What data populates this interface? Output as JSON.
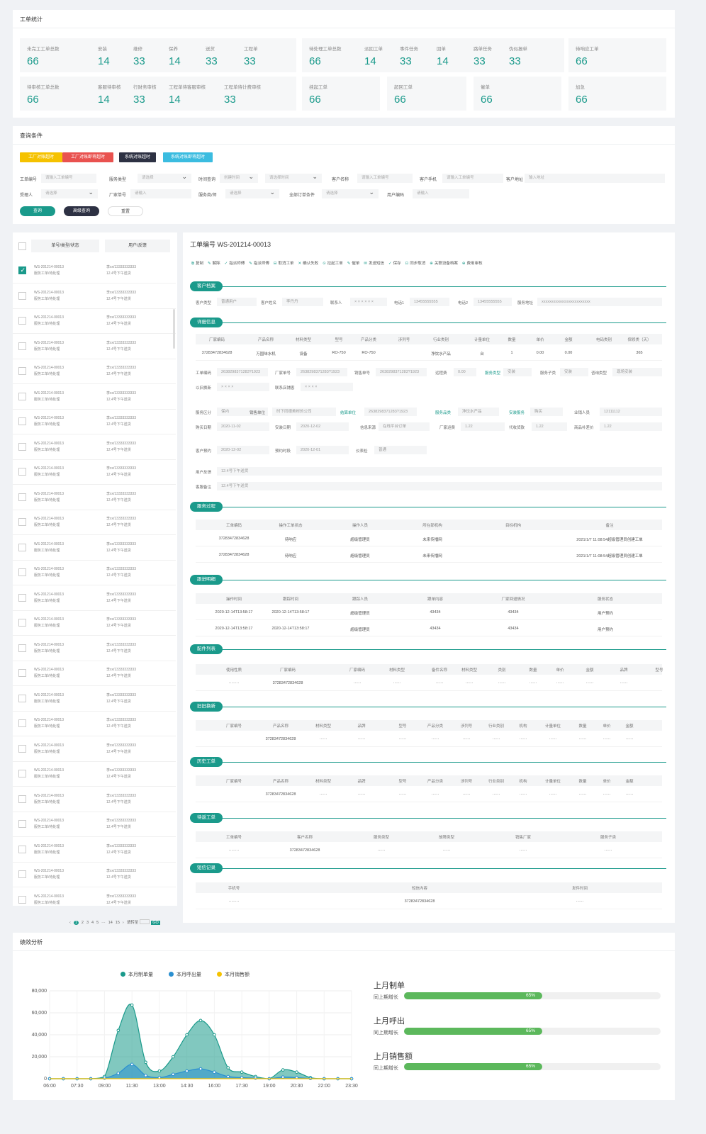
{
  "stats": {
    "title": "工单统计",
    "boxes": [
      {
        "items": [
          {
            "label": "未完工工单总数",
            "value": "66"
          },
          {
            "label": "安装",
            "value": "14"
          },
          {
            "label": "维修",
            "value": "33"
          },
          {
            "label": "保养",
            "value": "14"
          },
          {
            "label": "送货",
            "value": "33"
          },
          {
            "label": "工程单",
            "value": "33"
          }
        ]
      },
      {
        "items": [
          {
            "label": "待处理工单总数",
            "value": "66"
          },
          {
            "label": "派回工单",
            "value": "14"
          },
          {
            "label": "事件任务",
            "value": "33"
          },
          {
            "label": "回单",
            "value": "14"
          },
          {
            "label": "路单任务",
            "value": "33"
          },
          {
            "label": "伪似报单",
            "value": "33"
          }
        ]
      },
      {
        "items": [
          {
            "label": "待响应工单",
            "value": "66"
          }
        ]
      },
      {
        "items": [
          {
            "label": "待审核工单总数",
            "value": "66"
          },
          {
            "label": "客服待审核",
            "value": "14"
          },
          {
            "label": "行财务审核",
            "value": "33"
          },
          {
            "label": "工程单待客服审核",
            "value": "14"
          },
          {
            "label": "工程单待计费审核",
            "value": "33"
          }
        ]
      },
      {
        "items": [
          {
            "label": "挂起工单",
            "value": "66"
          }
        ]
      },
      {
        "items": [
          {
            "label": "超回工单",
            "value": "66"
          }
        ]
      },
      {
        "items": [
          {
            "label": "催单",
            "value": "66"
          }
        ]
      },
      {
        "items": [
          {
            "label": "加急",
            "value": "66"
          }
        ]
      }
    ]
  },
  "query": {
    "title": "查询条件",
    "buttons": [
      {
        "label": "工厂对账超时",
        "color": "#f5c200"
      },
      {
        "label": "工厂对账即将超时",
        "color": "#e9524f"
      },
      {
        "label": "系统对账超时",
        "color": "#2d3143"
      },
      {
        "label": "系统对账即将超时",
        "color": "#3bbce0"
      }
    ],
    "fields": [
      {
        "label": "工单编号",
        "ph": "请输入工单编号",
        "sel": false
      },
      {
        "label": "服务类型",
        "ph": "请选择",
        "sel": true
      },
      {
        "label": "时间查询",
        "ph": "创建时间",
        "sel": true
      },
      {
        "label": "",
        "ph": "请选择时间",
        "sel": true
      },
      {
        "label": "客户名称",
        "ph": "请输入工单编号",
        "sel": false
      },
      {
        "label": "客户手机",
        "ph": "请输入工单编号",
        "sel": false
      },
      {
        "label": "客户地址",
        "ph": "输入地址",
        "sel": false
      },
      {
        "label": "受理人",
        "ph": "请选择",
        "sel": true
      },
      {
        "label": "厂家单号",
        "ph": "请输入",
        "sel": false
      },
      {
        "label": "服务商/师",
        "ph": "请选择",
        "sel": true
      },
      {
        "label": "全部订单条件",
        "ph": "请选择",
        "sel": true
      },
      {
        "label": "用户编码",
        "ph": "请输入",
        "sel": false
      }
    ],
    "search": "查询",
    "advanced": "高级查询",
    "reset": "重置"
  },
  "list": {
    "col1": "单号/类型/状态",
    "col2": "用户/反馈",
    "rows": [
      {
        "no": "WS-201214-00013",
        "type": "服务工单/待处理",
        "user": "李xx/13333333333",
        "fb": "12.4号下午送货",
        "checked": true
      },
      {
        "no": "WS-201214-00013",
        "type": "服务工单/待处理",
        "user": "李xx/13333333333",
        "fb": "12.4号下午送货",
        "checked": false
      },
      {
        "no": "WS-201214-00013",
        "type": "服务工单/待处理",
        "user": "李xx/13333333333",
        "fb": "12.4号下午送货",
        "checked": false
      },
      {
        "no": "WS-201214-00013",
        "type": "服务工单/待处理",
        "user": "李xx/13333333333",
        "fb": "12.4号下午送货",
        "checked": false
      },
      {
        "no": "WS-201214-00013",
        "type": "服务工单/待处理",
        "user": "李xx/13333333333",
        "fb": "12.4号下午送货",
        "checked": false
      },
      {
        "no": "WS-201214-00013",
        "type": "服务工单/待处理",
        "user": "李xx/13333333333",
        "fb": "12.4号下午送货",
        "checked": false
      },
      {
        "no": "WS-201214-00013",
        "type": "服务工单/待处理",
        "user": "李xx/13333333333",
        "fb": "12.4号下午送货",
        "checked": false
      },
      {
        "no": "WS-201214-00013",
        "type": "服务工单/待处理",
        "user": "李xx/13333333333",
        "fb": "12.4号下午送货",
        "checked": false
      },
      {
        "no": "WS-201214-00013",
        "type": "服务工单/待处理",
        "user": "李xx/13333333333",
        "fb": "12.4号下午送货",
        "checked": false
      },
      {
        "no": "WS-201214-00013",
        "type": "服务工单/待处理",
        "user": "李xx/13333333333",
        "fb": "12.4号下午送货",
        "checked": false
      },
      {
        "no": "WS-201214-00013",
        "type": "服务工单/待处理",
        "user": "李xx/13333333333",
        "fb": "12.4号下午送货",
        "checked": false
      },
      {
        "no": "WS-201214-00013",
        "type": "服务工单/待处理",
        "user": "李xx/13333333333",
        "fb": "12.4号下午送货",
        "checked": false
      },
      {
        "no": "WS-201214-00013",
        "type": "服务工单/待处理",
        "user": "李xx/13333333333",
        "fb": "12.4号下午送货",
        "checked": false
      },
      {
        "no": "WS-201214-00013",
        "type": "服务工单/待处理",
        "user": "李xx/13333333333",
        "fb": "12.4号下午送货",
        "checked": false
      },
      {
        "no": "WS-201214-00013",
        "type": "服务工单/待处理",
        "user": "李xx/13333333333",
        "fb": "12.4号下午送货",
        "checked": false
      },
      {
        "no": "WS-201214-00013",
        "type": "服务工单/待处理",
        "user": "李xx/13333333333",
        "fb": "12.4号下午送货",
        "checked": false
      },
      {
        "no": "WS-201214-00013",
        "type": "服务工单/待处理",
        "user": "李xx/13333333333",
        "fb": "12.4号下午送货",
        "checked": false
      },
      {
        "no": "WS-201214-00013",
        "type": "服务工单/待处理",
        "user": "李xx/13333333333",
        "fb": "12.4号下午送货",
        "checked": false
      },
      {
        "no": "WS-201214-00013",
        "type": "服务工单/待处理",
        "user": "李xx/13333333333",
        "fb": "12.4号下午送货",
        "checked": false
      },
      {
        "no": "WS-201214-00013",
        "type": "服务工单/待处理",
        "user": "李xx/13333333333",
        "fb": "12.4号下午送货",
        "checked": false
      },
      {
        "no": "WS-201214-00013",
        "type": "服务工单/待处理",
        "user": "李xx/13333333333",
        "fb": "12.4号下午送货",
        "checked": false
      },
      {
        "no": "WS-201214-00013",
        "type": "服务工单/待处理",
        "user": "李xx/13333333333",
        "fb": "12.4号下午送货",
        "checked": false
      },
      {
        "no": "WS-201214-00013",
        "type": "服务工单/待处理",
        "user": "李xx/13333333333",
        "fb": "12.4号下午送货",
        "checked": false
      },
      {
        "no": "WS-201214-00013",
        "type": "服务工单/待处理",
        "user": "李xx/13333333333",
        "fb": "12.4号下午送货",
        "checked": false
      },
      {
        "no": "WS-201214-00013",
        "type": "服务工单/待处理",
        "user": "李xx/13333333333",
        "fb": "12.4号下午送货",
        "checked": false
      },
      {
        "no": "WS-201214-00013",
        "type": "服务工单/待处理",
        "user": "李xx/13333333333",
        "fb": "12.4号下午送货",
        "checked": false
      }
    ],
    "pagination": {
      "prev": "‹",
      "pages": [
        "1",
        "2",
        "3",
        "4",
        "5",
        "···",
        "14",
        "15",
        "›"
      ],
      "goto": "请转至",
      "go": "GO"
    }
  },
  "detail": {
    "title": "工单编号  WS-201214-00013",
    "toolbar": [
      "复制",
      "解除",
      "指派师傅",
      "指派师傅",
      "取消工单",
      "确认失败",
      "拉起工单",
      "催单",
      "发送短信",
      "保存",
      "同步取消",
      "关联设备档案",
      "费用审核"
    ],
    "sections": {
      "customer": "客户档案",
      "info": "详细信息",
      "process": "服务过程",
      "track": "跟进明细",
      "parts": "配件列表",
      "old": "旧旧换新",
      "history": "历史工单",
      "repair": "待返工单",
      "sms": "短信记录"
    },
    "customer": [
      {
        "l": "客户类型",
        "v": "普通用户"
      },
      {
        "l": "客户姓名",
        "v": "李丹丹"
      },
      {
        "l": "联系人",
        "v": "× × × × × ×"
      },
      {
        "l": "电话1",
        "v": "13455555555"
      },
      {
        "l": "电话2",
        "v": "13455555555"
      },
      {
        "l": "服务地址",
        "v": "xxxxxxxxxxxxxxxxxxxxxxxxx"
      }
    ],
    "product_head": [
      "厂家编码",
      "产品名称",
      "材料类型",
      "型号",
      "产品分类",
      "涉列号",
      "行业类别",
      "计量单位",
      "数量",
      "单价",
      "金额",
      "电码类别",
      "保修类（天）"
    ],
    "product_row": [
      "37283472834628",
      "万国味水机",
      "设备",
      "RO-750",
      "RO-750",
      "",
      "净饮水产品",
      "台",
      "1",
      "0.00",
      "0.00",
      "",
      "365"
    ],
    "info_a": [
      {
        "l": "工单编码",
        "v": "2638298371283?1923"
      },
      {
        "l": "厂家单号",
        "v": "2638298371283?1923"
      },
      {
        "l": "销售单号",
        "v": "2638298371283?1923"
      },
      {
        "l": "远程费",
        "v": "0.00"
      },
      {
        "l": "服务类型",
        "v": "安装",
        "link": true
      },
      {
        "l": "服务子类",
        "v": "安装"
      },
      {
        "l": "咨询类型",
        "v": "现场安装"
      }
    ],
    "info_b": [
      {
        "l": "以旧换新",
        "v": "× × × ×"
      },
      {
        "l": "联系店铺客",
        "v": "× × × ×"
      }
    ],
    "info_c": [
      {
        "l": "服务区分",
        "v": "保内"
      },
      {
        "l": "销售单位",
        "v": "时下同德美材的公司"
      },
      {
        "l": "结算单位",
        "v": "2638298371283?1923",
        "link": true
      },
      {
        "l": "服务品类",
        "v": "净饮水产品",
        "link": true
      },
      {
        "l": "安装服务",
        "v": "购买",
        "link": true
      },
      {
        "l": "业销人员",
        "v": "12111112"
      }
    ],
    "info_d": [
      {
        "l": "购买日期",
        "v": "2020-11-02"
      },
      {
        "l": "安装日期",
        "v": "2020-12-02"
      },
      {
        "l": "信息来源",
        "v": "在线平台订单"
      },
      {
        "l": "厂家运费",
        "v": "1.22"
      },
      {
        "l": "代收货款",
        "v": "1.22"
      },
      {
        "l": "商品补差价",
        "v": "1.22"
      }
    ],
    "info_e": [
      {
        "l": "客户预约",
        "v": "2020-12-02"
      },
      {
        "l": "预约时段",
        "v": "2020-12-01"
      },
      {
        "l": "仪表检",
        "v": "普通"
      }
    ],
    "info_f": [
      {
        "l": "用户反馈",
        "v": "12.4号下午送货"
      },
      {
        "l": "客服备注",
        "v": "12.4号下午送货"
      }
    ],
    "process_head": [
      "工单编码",
      "操作工单状态",
      "操作人员",
      "所在部机构",
      "目标机构",
      "备注"
    ],
    "process_rows": [
      [
        "37283472834628",
        "待响应",
        "超级管理员",
        "未来传播网",
        "",
        "2021/1/7 11:08:54超级管理员创建工单"
      ],
      [
        "37283472834628",
        "待响应",
        "超级管理员",
        "未来传播网",
        "",
        "2021/1/7 11:08:54超级管理员创建工单"
      ]
    ],
    "track_head": [
      "操作时间",
      "跟踪时间",
      "跟踪人员",
      "跟单内容",
      "厂家回退情况",
      "服务状态"
    ],
    "track_rows": [
      [
        "2020-12-14T13:58:17",
        "2020-12-14T13:58:17",
        "超级管理员",
        "43434",
        "43434",
        "用户预约"
      ],
      [
        "2020-12-14T13:58:17",
        "2020-12-14T13:58:17",
        "超级管理员",
        "43434",
        "43434",
        "用户预约"
      ]
    ],
    "parts_head": [
      "使用性质",
      "厂家编码",
      "厂家编码",
      "材料类型",
      "备件名称",
      "材料类型",
      "类别",
      "数量",
      "单价",
      "金额",
      "品牌",
      "型号"
    ],
    "parts_row": [
      "········",
      "37283472834628",
      "······",
      "······",
      "······",
      "······",
      "······",
      "······",
      "······",
      "······",
      "······"
    ],
    "old_head": [
      "厂家编号",
      "产品名称",
      "材料类型",
      "品牌",
      "型号",
      "产品分类",
      "涉列号",
      "行业类别",
      "机构",
      "计量单位",
      "数量",
      "单价",
      "金额"
    ],
    "old_row": [
      "",
      "37283472834628",
      "······",
      "······",
      "······",
      "······",
      "······",
      "······",
      "······",
      "······",
      "······",
      "······",
      "······"
    ],
    "hist_head": [
      "厂家编号",
      "产品名称",
      "材料类型",
      "品牌",
      "型号",
      "产品分类",
      "涉列号",
      "行业类别",
      "机构",
      "计量单位",
      "数量",
      "单价",
      "金额"
    ],
    "hist_row": [
      "",
      "37283472834628",
      "······",
      "······",
      "······",
      "······",
      "······",
      "······",
      "······",
      "······",
      "······",
      "······",
      "······"
    ],
    "repair_head": [
      "工单编号",
      "客户名称",
      "服务类型",
      "故障类型",
      "销售厂家",
      "服务子类"
    ],
    "repair_row": [
      "········",
      "37283472834628",
      "······",
      "······",
      "······",
      "······"
    ],
    "sms_head": [
      "手机号",
      "短信内容",
      "发件时间"
    ],
    "sms_row": [
      "········",
      "37283472834628",
      "······"
    ]
  },
  "perf": {
    "title": "绩效分析",
    "legend": [
      {
        "name": "本月制单量",
        "color": "#1a9a8b"
      },
      {
        "name": "本月呼出量",
        "color": "#2a8fd0"
      },
      {
        "name": "本月销售额",
        "color": "#f5c200"
      }
    ],
    "metrics": [
      {
        "title": "上月制单",
        "sub": "同上期增长",
        "pct": 65,
        "label": "65%"
      },
      {
        "title": "上月呼出",
        "sub": "同上期增长",
        "pct": 65,
        "label": "65%"
      },
      {
        "title": "上月销售额",
        "sub": "同上期增长",
        "pct": 65,
        "label": "65%"
      }
    ]
  },
  "chart_data": {
    "type": "area",
    "x": [
      "06:00",
      "07:00",
      "07:30",
      "08:00",
      "09:00",
      "10:00",
      "11:30",
      "12:00",
      "13:00",
      "14:00",
      "14:30",
      "15:00",
      "16:00",
      "17:00",
      "17:30",
      "18:00",
      "19:00",
      "20:00",
      "20:30",
      "21:00",
      "22:00",
      "23:00",
      "23:30"
    ],
    "xticks": [
      "06:00",
      "07:30",
      "09:00",
      "11:30",
      "13:00",
      "14:30",
      "16:00",
      "17:30",
      "19:00",
      "20:30",
      "22:00",
      "23:30"
    ],
    "yticks": [
      "0",
      "20,000",
      "40,000",
      "60,000",
      "80,000"
    ],
    "ylim": [
      0,
      80000
    ],
    "series": [
      {
        "name": "本月制单量",
        "values": [
          0,
          0,
          0,
          0,
          2000,
          44000,
          67000,
          15000,
          7000,
          20000,
          40000,
          53000,
          40000,
          10000,
          6000,
          2000,
          0,
          8000,
          6000,
          1000,
          0,
          0,
          0
        ]
      },
      {
        "name": "本月呼出量",
        "values": [
          0,
          0,
          0,
          0,
          500,
          5000,
          13000,
          3000,
          1000,
          4000,
          7000,
          9000,
          6000,
          2000,
          1000,
          500,
          0,
          1500,
          1000,
          200,
          0,
          0,
          0
        ]
      },
      {
        "name": "本月销售额",
        "values": [
          0,
          0,
          0,
          0,
          0,
          0,
          0,
          0,
          0,
          0,
          0,
          0,
          0,
          0,
          0,
          0,
          0,
          0,
          0,
          0,
          0,
          0,
          0
        ]
      }
    ]
  }
}
